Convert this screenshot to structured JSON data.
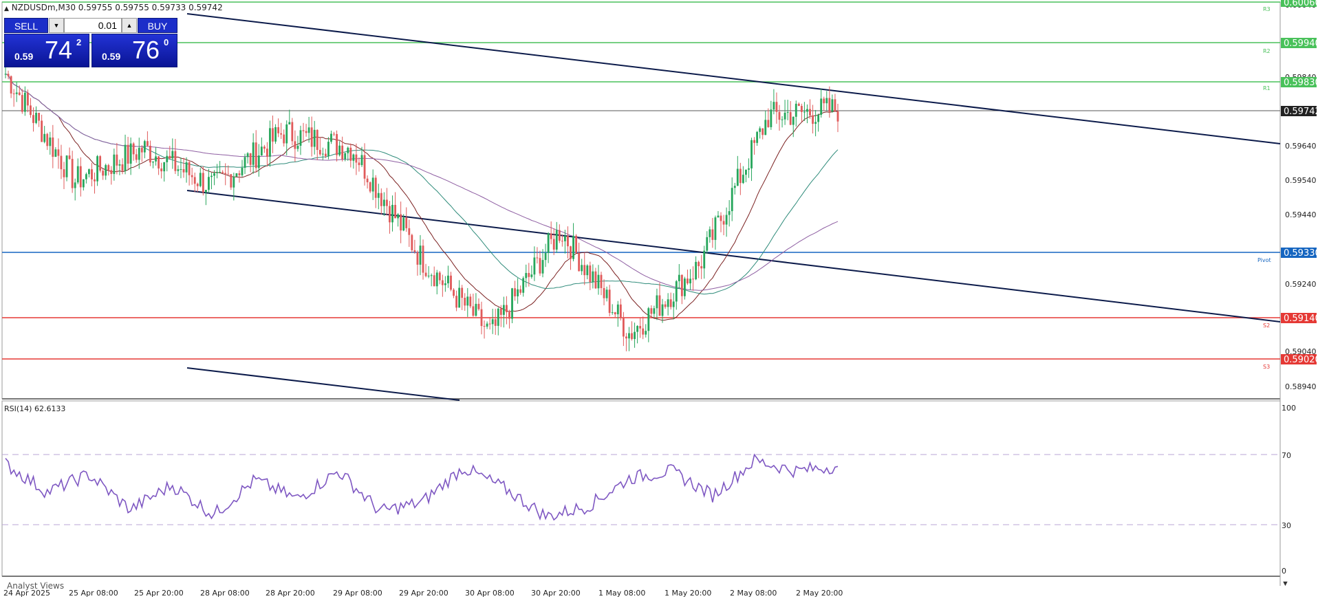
{
  "header": {
    "symbol_line": "NZDUSDm,M30  0.59755 0.59755 0.59733 0.59742",
    "collapse_icon": "triangle-up-icon"
  },
  "trade_panel": {
    "sell_label": "SELL",
    "buy_label": "BUY",
    "lot_value": "0.01",
    "sell_prefix": "0.59",
    "sell_big": "74",
    "sell_sup": "2",
    "buy_prefix": "0.59",
    "buy_big": "76",
    "buy_sup": "0",
    "decrement_icon": "chevron-down-icon",
    "increment_icon": "chevron-up-icon",
    "button_color": "#1c2ec9"
  },
  "price_axis": {
    "ticks": [
      "0.60040",
      "0.59840",
      "0.59640",
      "0.59540",
      "0.59440",
      "0.59240",
      "0.59040",
      "0.58940"
    ]
  },
  "levels": [
    {
      "name": "R3",
      "price": "0.60060",
      "color": "#49c15a"
    },
    {
      "name": "R2",
      "price": "0.59940",
      "color": "#49c15a"
    },
    {
      "name": "R1",
      "price": "0.59830",
      "color": "#49c15a"
    },
    {
      "name": "Current",
      "price": "0.59742",
      "color": "#222222"
    },
    {
      "name": "Pivot",
      "price": "0.59330",
      "color": "#1565c0"
    },
    {
      "name": "S2",
      "price": "0.59140",
      "color": "#e53935"
    },
    {
      "name": "S3",
      "price": "0.59020",
      "color": "#e53935"
    }
  ],
  "time_axis": {
    "labels": [
      "24 Apr 2025",
      "25 Apr 08:00",
      "25 Apr 20:00",
      "28 Apr 08:00",
      "28 Apr 20:00",
      "29 Apr 08:00",
      "29 Apr 20:00",
      "30 Apr 08:00",
      "30 Apr 20:00",
      "1 May 08:00",
      "1 May 20:00",
      "2 May 08:00",
      "2 May 20:00"
    ]
  },
  "rsi": {
    "title": "RSI(14) 62.6133",
    "levels": [
      "100",
      "70",
      "30",
      "0"
    ],
    "line_color": "#7e57c2"
  },
  "footer": {
    "analyst_views": "Analyst Views"
  },
  "colors": {
    "bull_candle": "#26a65b",
    "bear_candle": "#e05a5a",
    "channel_line": "#0b1a4a",
    "ma_fast": "#7a1f1f",
    "ma_mid": "#2e8b7a",
    "ma_slow": "#8e5ea2"
  },
  "chart_data": {
    "type": "candlestick",
    "symbol": "NZDUSDm",
    "timeframe": "M30",
    "ohlc_last": {
      "open": 0.59755,
      "high": 0.59755,
      "low": 0.59733,
      "close": 0.59742
    },
    "ylim": [
      0.5885,
      0.6007
    ],
    "close_path": [
      {
        "t": "24 Apr 2025",
        "price": 0.5985
      },
      {
        "t": "25 Apr 08:00",
        "price": 0.5952
      },
      {
        "t": "25 Apr 20:00",
        "price": 0.5962
      },
      {
        "t": "28 Apr 08:00",
        "price": 0.595
      },
      {
        "t": "28 Apr 20:00",
        "price": 0.5967
      },
      {
        "t": "29 Apr 08:00",
        "price": 0.5962
      },
      {
        "t": "29 Apr 20:00",
        "price": 0.5928
      },
      {
        "t": "30 Apr 08:00",
        "price": 0.5905
      },
      {
        "t": "30 Apr 20:00",
        "price": 0.5937
      },
      {
        "t": "1 May 08:00",
        "price": 0.5905
      },
      {
        "t": "1 May 20:00",
        "price": 0.5926
      },
      {
        "t": "2 May 08:00",
        "price": 0.5972
      },
      {
        "t": "2 May 20:00",
        "price": 0.5974
      }
    ],
    "rsi_path": [
      64,
      48,
      58,
      38,
      52,
      35,
      55,
      44,
      60,
      37,
      42,
      62,
      50,
      34,
      40,
      56,
      60,
      46,
      66,
      60,
      63
    ],
    "rsi_last": 62.6133
  }
}
